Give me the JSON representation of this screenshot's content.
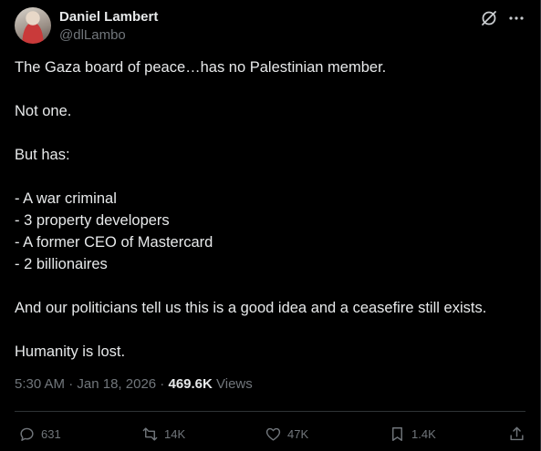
{
  "author": {
    "display_name": "Daniel Lambert",
    "handle": "@dlLambo"
  },
  "header_icons": [
    "grok-icon",
    "more-icon"
  ],
  "post": {
    "lines": [
      "The Gaza board of peace…has no Palestinian member.",
      "",
      "Not one.",
      "",
      "But has:",
      "",
      "- A war criminal",
      "- 3 property developers",
      "- A former CEO of Mastercard",
      "- 2 billionaires",
      "",
      "And our politicians tell us this is a good idea and a ceasefire still exists.",
      "",
      "Humanity is lost."
    ]
  },
  "meta": {
    "time": "5:30 AM",
    "separator": " · ",
    "date": "Jan 18, 2026",
    "separator2": " · ",
    "views_count": "469.6K",
    "views_label": " Views"
  },
  "actions": {
    "replies": "631",
    "reposts": "14K",
    "likes": "47K",
    "bookmarks": "1.4K"
  },
  "colors": {
    "background": "#000000",
    "text": "#e7e9ea",
    "secondary": "#71767b",
    "border": "#2f3336"
  }
}
